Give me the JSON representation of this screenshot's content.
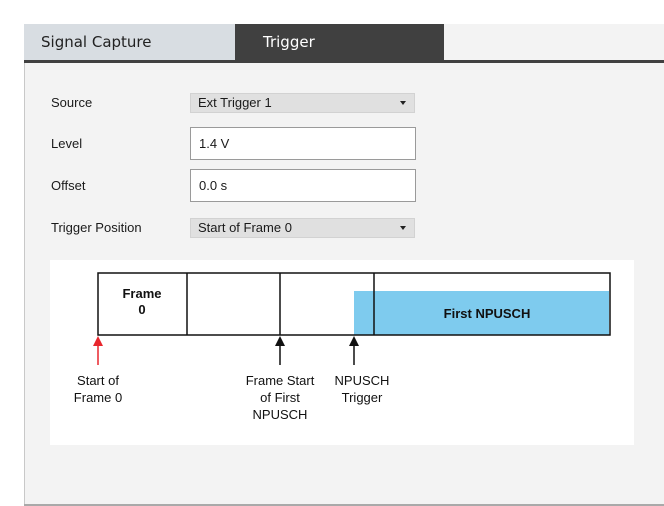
{
  "tabs": {
    "signal_capture": "Signal Capture",
    "trigger": "Trigger"
  },
  "form": {
    "source_label": "Source",
    "source_value": "Ext Trigger 1",
    "level_label": "Level",
    "level_value": "1.4 V",
    "offset_label": "Offset",
    "offset_value": "0.0 s",
    "trigger_position_label": "Trigger Position",
    "trigger_position_value": "Start of Frame 0"
  },
  "diagram": {
    "frame_label_line1": "Frame",
    "frame_label_line2": "0",
    "npusch_label": "First NPUSCH",
    "start_of_frame_line1": "Start of",
    "start_of_frame_line2": "Frame 0",
    "frame_start_line1": "Frame Start",
    "frame_start_line2": "of First",
    "frame_start_line3": "NPUSCH",
    "npusch_trigger_line1": "NPUSCH",
    "npusch_trigger_line2": "Trigger"
  },
  "colors": {
    "npusch_fill": "#7ecbee",
    "red_arrow": "#e8262d",
    "tab_active": "#404040",
    "tab_inactive": "#d8dde2"
  }
}
